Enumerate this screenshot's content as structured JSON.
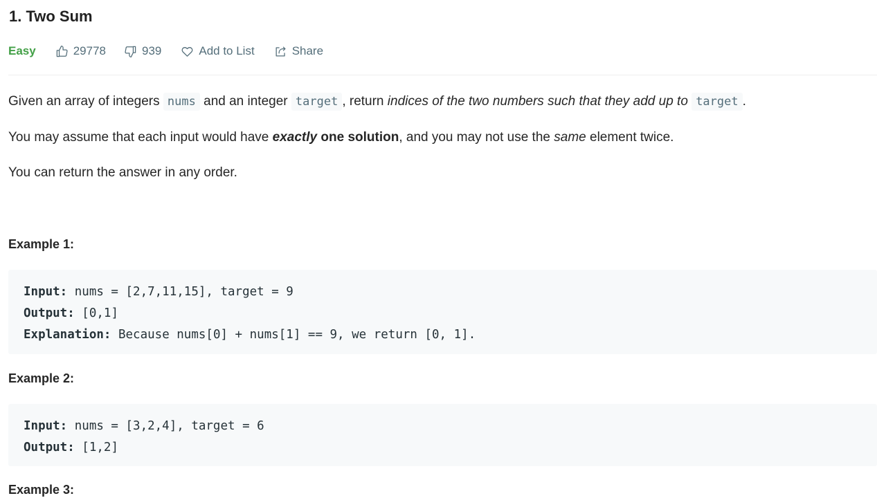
{
  "problem": {
    "title": "1. Two Sum",
    "difficulty": "Easy",
    "likes": "29778",
    "dislikes": "939",
    "add_to_list": "Add to List",
    "share": "Share"
  },
  "description": {
    "p1": {
      "t1": "Given an array of integers ",
      "code1": "nums",
      "t2": " and an integer ",
      "code2": "target",
      "t3": ", return ",
      "em": "indices of the two numbers such that they add up to",
      "t4": " ",
      "code3": "target",
      "t5": "."
    },
    "p2": {
      "t1": "You may assume that each input would have ",
      "strong_em": "exactly",
      "t2": " ",
      "strong": "one solution",
      "t3": ", and you may not use the ",
      "em": "same",
      "t4": " element twice."
    },
    "p3": "You can return the answer in any order."
  },
  "examples": [
    {
      "title": "Example 1:",
      "input_label": "Input:",
      "input_value": " nums = [2,7,11,15], target = 9",
      "output_label": "Output:",
      "output_value": " [0,1]",
      "explanation_label": "Explanation:",
      "explanation_value": " Because nums[0] + nums[1] == 9, we return [0, 1]."
    },
    {
      "title": "Example 2:",
      "input_label": "Input:",
      "input_value": " nums = [3,2,4], target = 6",
      "output_label": "Output:",
      "output_value": " [1,2]"
    },
    {
      "title": "Example 3:"
    }
  ],
  "icons": {
    "likes": "thumbs-up-icon",
    "dislikes": "thumbs-down-icon",
    "add_to_list": "heart-icon",
    "share": "share-icon"
  },
  "colors": {
    "easy": "#43a047",
    "meta_text": "#546e7a",
    "code_bg": "#f7f9fa"
  }
}
